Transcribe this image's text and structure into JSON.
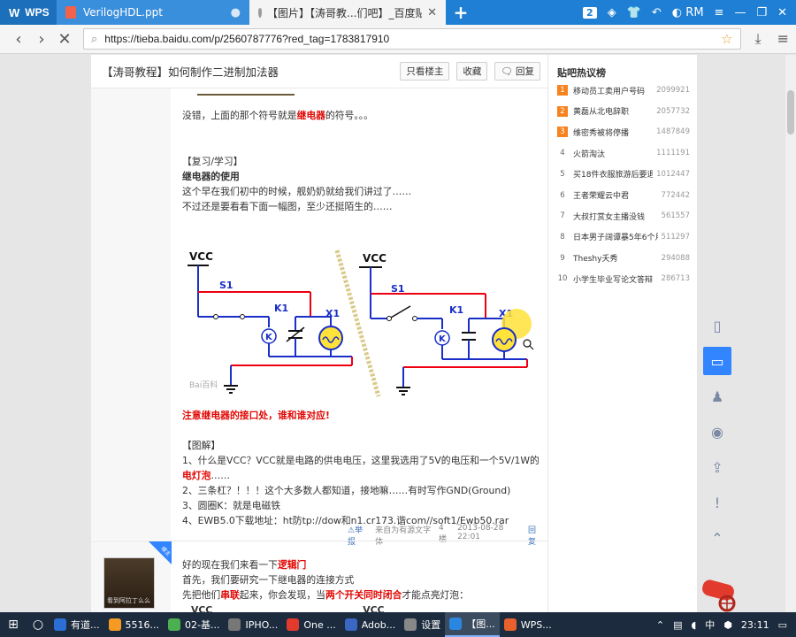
{
  "browser": {
    "tabs": [
      {
        "label": "WPS"
      },
      {
        "label": "VerilogHDL.ppt"
      },
      {
        "label": "【图片】【涛哥教...们吧】_百度贴吧"
      }
    ],
    "tab_count": "2",
    "user": "RM",
    "url": "https://tieba.baidu.com/p/2560787776?red_tag=1783817910"
  },
  "post": {
    "title": "【涛哥教程】如何制作二进制加法器",
    "buttons": {
      "only_owner": "只看楼主",
      "collect": "收藏",
      "reply": "回复"
    },
    "floor1": {
      "line_relay_symbol_pre": "没错，上面的那个符号就是",
      "line_relay_symbol_red": "继电器",
      "line_relay_symbol_post": "的符号。。。",
      "review_head": "【复习/学习】",
      "relay_use": "继电器的使用",
      "line_a": "这个早在我们初中的时候，舰奶奶就给我们讲过了……",
      "line_b": "不过还是要看看下面一幅图，至少还挺陌生的……",
      "figure": {
        "vcc": "VCC",
        "s1": "S1",
        "k1": "K1",
        "x1": "X1",
        "watermark": "Bai百科"
      },
      "notice": "注意继电器的接口处，谁和谁对应!",
      "explain_head": "【图解】",
      "item1_pre": "1、什么是VCC？VCC就是电路的供电电压，这里我选用了5V的电压和一个5V/1W的",
      "item1_red": "电灯泡",
      "item1_post": "……",
      "item2": "2、三条杠？！！！这个大多数人都知道，接地嘛……有时写作GND(Ground)",
      "item3": "3、圆圈K：就是电磁铁",
      "item4": "4、EWB5.0下载地址：ht防tp://dow和n1.cr173.谐com//soft1/Ewb50.rar"
    },
    "footer": {
      "report": "⚠举报",
      "client": "来自为有源文字体",
      "floor": "4楼",
      "time": "2013-08-28 22:01",
      "reply": "回复"
    },
    "floor2": {
      "owner_tag": "楼主",
      "avatar_caption": "看到阿拉丁么么",
      "line1_pre": "好的现在我们来看一下",
      "line1_red": "逻辑门",
      "line2": "首先，我们要研究一下继电器的连接方式",
      "line3_a": "先把他们",
      "line3_b": "串联",
      "line3_c": "起来，你会发现，当",
      "line3_d": "两个开关同时闭合",
      "line3_e": "才能点亮灯泡："
    }
  },
  "hot_list": {
    "title": "贴吧热议榜",
    "items": [
      {
        "rank": "1",
        "name": "移动员工卖用户号码",
        "count": "2099921"
      },
      {
        "rank": "2",
        "name": "黄磊从北电辞职",
        "count": "2057732"
      },
      {
        "rank": "3",
        "name": "维密秀被将停播",
        "count": "1487849"
      },
      {
        "rank": "4",
        "name": "火箭淘汰",
        "count": "1111191"
      },
      {
        "rank": "5",
        "name": "买18件衣服旅游后要退",
        "count": "1012447"
      },
      {
        "rank": "6",
        "name": "王者荣耀云中君",
        "count": "772442"
      },
      {
        "rank": "7",
        "name": "大叔打赏女主播没钱",
        "count": "561557"
      },
      {
        "rank": "8",
        "name": "日本男子阔谭暴5年6个月",
        "count": "511297"
      },
      {
        "rank": "9",
        "name": "Theshy夭秀",
        "count": "294088"
      },
      {
        "rank": "10",
        "name": "小学生毕业写论文答辩",
        "count": "286713"
      }
    ]
  },
  "taskbar": {
    "items": [
      {
        "label": "有道..."
      },
      {
        "label": "5516..."
      },
      {
        "label": "02-基..."
      },
      {
        "label": "IPHO..."
      },
      {
        "label": "One ..."
      },
      {
        "label": "Adob..."
      },
      {
        "label": "设置"
      },
      {
        "label": "【图..."
      },
      {
        "label": "WPS..."
      }
    ],
    "ime": "中",
    "clock": "23:11"
  },
  "colors": {
    "accent": "#1f7fd4",
    "red_text": "#e10602",
    "hot_rank": "#f7831f",
    "active_tool": "#3385ff"
  }
}
